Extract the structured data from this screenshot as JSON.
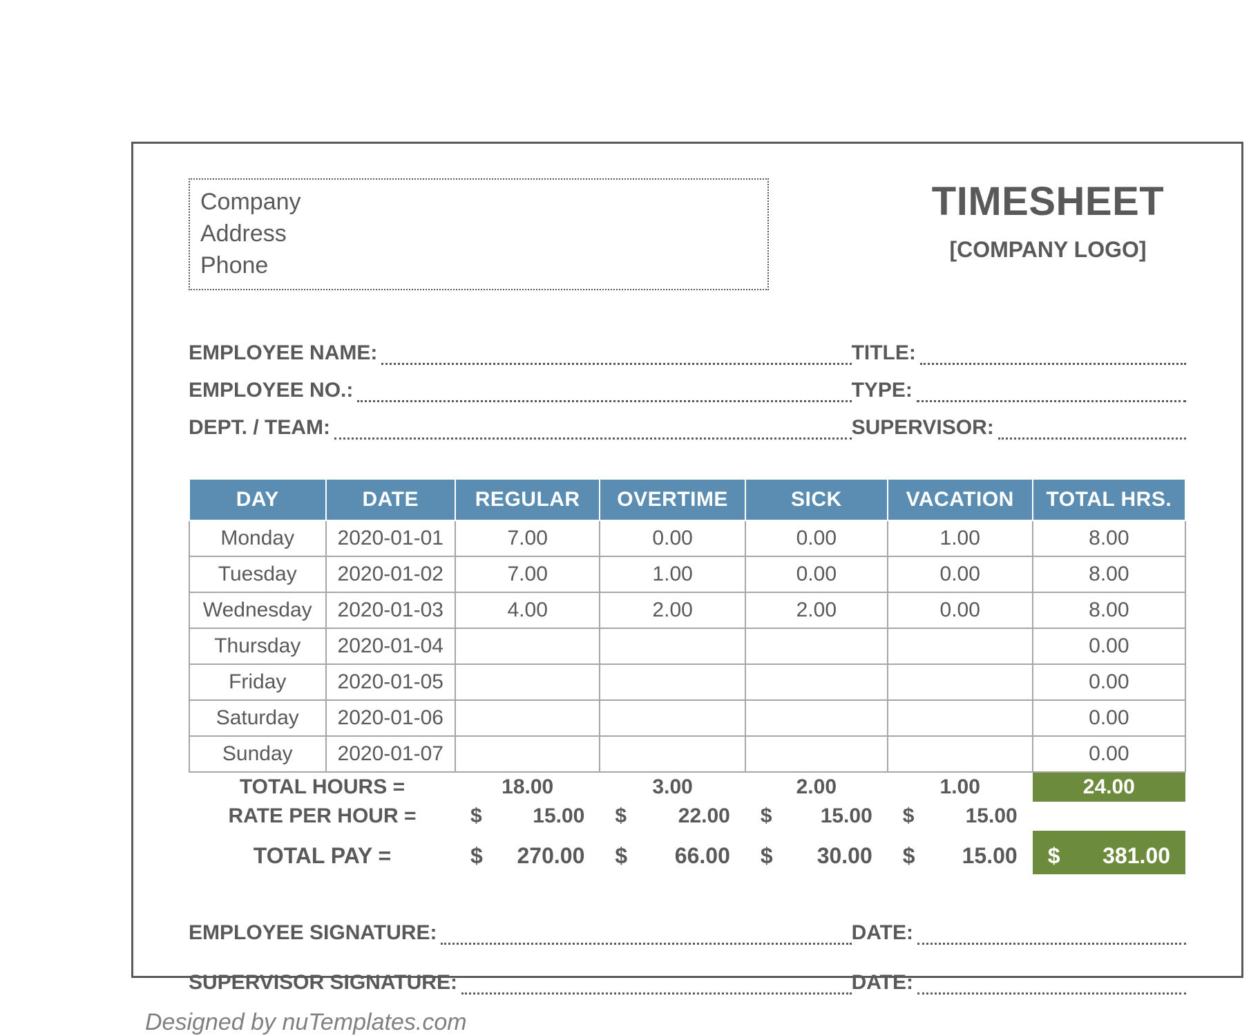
{
  "header": {
    "company": "Company",
    "address": "Address",
    "phone": "Phone",
    "title": "TIMESHEET",
    "logo": "[COMPANY LOGO]"
  },
  "employee_info": {
    "name_label": "EMPLOYEE NAME:",
    "no_label": "EMPLOYEE NO.:",
    "dept_label": "DEPT. / TEAM:",
    "title_label": "TITLE:",
    "type_label": "TYPE:",
    "supervisor_label": "SUPERVISOR:"
  },
  "columns": {
    "day": "DAY",
    "date": "DATE",
    "regular": "REGULAR",
    "overtime": "OVERTIME",
    "sick": "SICK",
    "vacation": "VACATION",
    "total": "TOTAL HRS."
  },
  "rows": [
    {
      "day": "Monday",
      "date": "2020-01-01",
      "regular": "7.00",
      "overtime": "0.00",
      "sick": "0.00",
      "vacation": "1.00",
      "total": "8.00"
    },
    {
      "day": "Tuesday",
      "date": "2020-01-02",
      "regular": "7.00",
      "overtime": "1.00",
      "sick": "0.00",
      "vacation": "0.00",
      "total": "8.00"
    },
    {
      "day": "Wednesday",
      "date": "2020-01-03",
      "regular": "4.00",
      "overtime": "2.00",
      "sick": "2.00",
      "vacation": "0.00",
      "total": "8.00"
    },
    {
      "day": "Thursday",
      "date": "2020-01-04",
      "regular": "",
      "overtime": "",
      "sick": "",
      "vacation": "",
      "total": "0.00"
    },
    {
      "day": "Friday",
      "date": "2020-01-05",
      "regular": "",
      "overtime": "",
      "sick": "",
      "vacation": "",
      "total": "0.00"
    },
    {
      "day": "Saturday",
      "date": "2020-01-06",
      "regular": "",
      "overtime": "",
      "sick": "",
      "vacation": "",
      "total": "0.00"
    },
    {
      "day": "Sunday",
      "date": "2020-01-07",
      "regular": "",
      "overtime": "",
      "sick": "",
      "vacation": "",
      "total": "0.00"
    }
  ],
  "summary": {
    "total_hours_label": "TOTAL HOURS =",
    "rate_label": "RATE PER HOUR =",
    "pay_label": "TOTAL PAY =",
    "hours": {
      "regular": "18.00",
      "overtime": "3.00",
      "sick": "2.00",
      "vacation": "1.00",
      "total": "24.00"
    },
    "rate": {
      "regular": "15.00",
      "overtime": "22.00",
      "sick": "15.00",
      "vacation": "15.00"
    },
    "pay": {
      "regular": "270.00",
      "overtime": "66.00",
      "sick": "30.00",
      "vacation": "15.00",
      "total": "381.00"
    },
    "currency": "$"
  },
  "signatures": {
    "emp_sig": "EMPLOYEE SIGNATURE:",
    "sup_sig": "SUPERVISOR SIGNATURE:",
    "date": "DATE:"
  },
  "footer": "Designed by nuTemplates.com"
}
